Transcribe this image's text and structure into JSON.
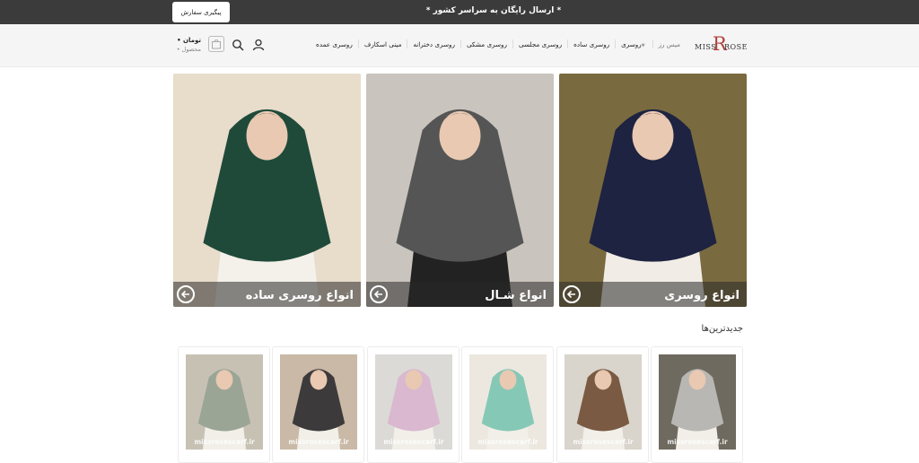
{
  "topbar": {
    "track_order_label": "پیگیری سفارش",
    "promo_text": "* ارسال رایگان به سراسر کشور *"
  },
  "header": {
    "logo_left": "MISS",
    "logo_mark": "R",
    "logo_right": "ROSE",
    "menu": [
      {
        "label": "میس رز",
        "has_dropdown": false
      },
      {
        "label": "روسری",
        "has_dropdown": true
      },
      {
        "label": "روسری ساده",
        "has_dropdown": false
      },
      {
        "label": "روسری مجلسی",
        "has_dropdown": false
      },
      {
        "label": "روسری مشکی",
        "has_dropdown": false
      },
      {
        "label": "روسری دخترانه",
        "has_dropdown": false
      },
      {
        "label": "مینی اسکارف",
        "has_dropdown": false
      },
      {
        "label": "روسری عمده",
        "has_dropdown": false
      }
    ],
    "cart_price": "• تومان",
    "cart_count": "• محصول",
    "icons": [
      "user-icon",
      "search-icon",
      "cart-icon"
    ]
  },
  "banners": [
    {
      "title": "انواع روسری ساده",
      "scarf_color": "#1f4a3a",
      "bg_color": "#e8dccb",
      "dress_color": "#f4f1ea"
    },
    {
      "title": "انواع شـال",
      "scarf_color": "#555555",
      "bg_color": "#c9c4bd",
      "dress_color": "#222222"
    },
    {
      "title": "انواع روسری",
      "scarf_color": "#1d2340",
      "bg_color": "#7a6a3f",
      "dress_color": "#f1ede6"
    }
  ],
  "section": {
    "title": "جدیدترین‌ها"
  },
  "products": [
    {
      "watermark": "missrosescarf.ir",
      "scarf_color": "#b9b7b3",
      "bg_color": "#6f6a60"
    },
    {
      "watermark": "missrosescarf.ir",
      "scarf_color": "#7a5a42",
      "bg_color": "#d9d4cc"
    },
    {
      "watermark": "missrosescarf.ir",
      "scarf_color": "#86c8b6",
      "bg_color": "#ece8e0"
    },
    {
      "watermark": "missrosescarf.ir",
      "scarf_color": "#d9b8d0",
      "bg_color": "#dcdad6"
    },
    {
      "watermark": "missrosescarf.ir",
      "scarf_color": "#3d3a3c",
      "bg_color": "#c9b9a6"
    },
    {
      "watermark": "missrosescarf.ir",
      "scarf_color": "#9aa596",
      "bg_color": "#c7c1b4"
    }
  ]
}
